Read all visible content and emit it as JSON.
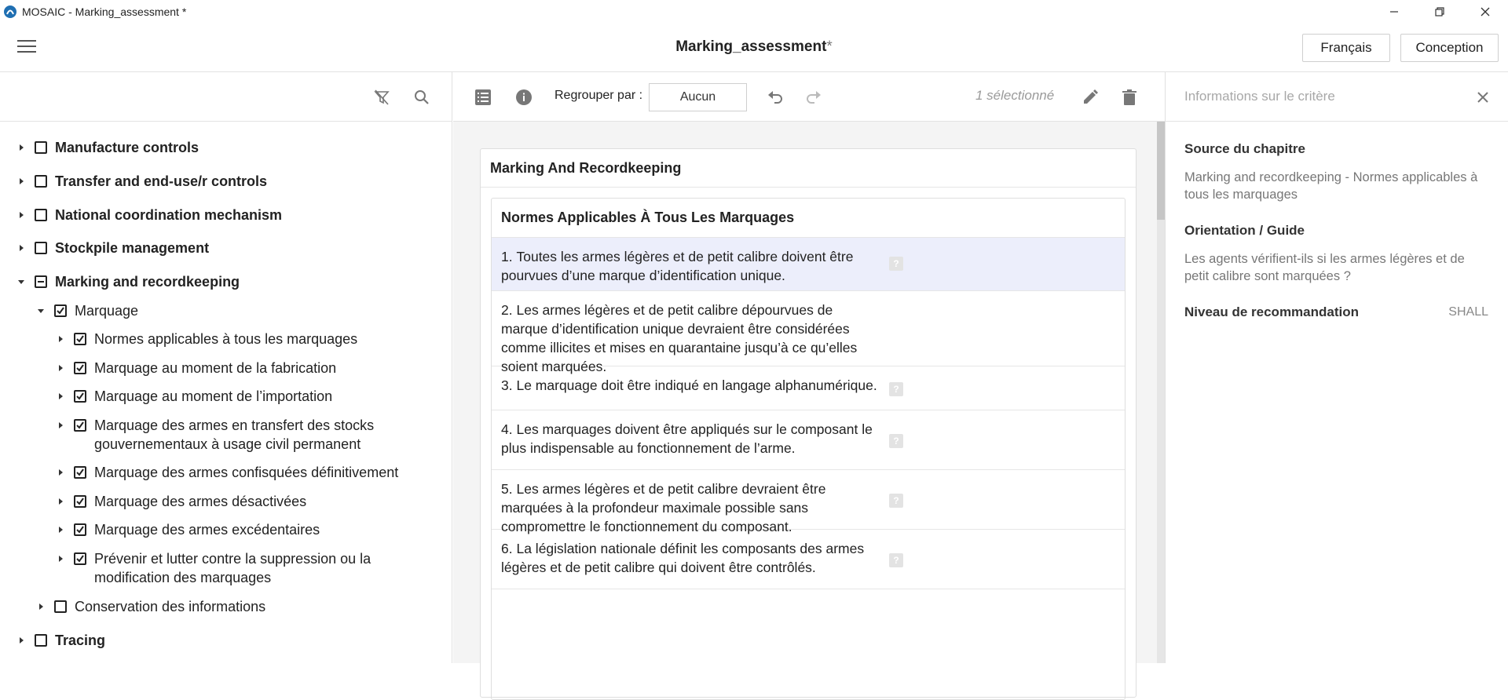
{
  "window": {
    "title": "MOSAIC - Marking_assessment *"
  },
  "header": {
    "doc_title": "Marking_assessment",
    "modified_mark": "*",
    "language_button": "Français",
    "mode_button": "Conception"
  },
  "tree": {
    "items": [
      {
        "label": "Manufacture controls",
        "level": 0,
        "expanded": false,
        "checked": "none",
        "bold": true
      },
      {
        "label": "Transfer and end-use/r controls",
        "level": 0,
        "expanded": false,
        "checked": "none",
        "bold": true
      },
      {
        "label": "National coordination mechanism",
        "level": 0,
        "expanded": false,
        "checked": "none",
        "bold": true
      },
      {
        "label": "Stockpile management",
        "level": 0,
        "expanded": false,
        "checked": "none",
        "bold": true
      },
      {
        "label": "Marking and recordkeeping",
        "level": 0,
        "expanded": true,
        "checked": "partial",
        "bold": true
      },
      {
        "label": "Marquage",
        "level": 1,
        "expanded": true,
        "checked": "checked",
        "bold": false
      },
      {
        "label": "Normes applicables à tous les marquages",
        "level": 2,
        "expanded": false,
        "checked": "checked",
        "bold": false
      },
      {
        "label": "Marquage au moment de la fabrication",
        "level": 2,
        "expanded": false,
        "checked": "checked",
        "bold": false
      },
      {
        "label": "Marquage au moment de l’importation",
        "level": 2,
        "expanded": false,
        "checked": "checked",
        "bold": false
      },
      {
        "label": "Marquage des armes en transfert des stocks\ngouvernementaux à usage civil permanent",
        "level": 2,
        "expanded": false,
        "checked": "checked",
        "bold": false
      },
      {
        "label": "Marquage des armes confisquées définitivement",
        "level": 2,
        "expanded": false,
        "checked": "checked",
        "bold": false
      },
      {
        "label": "Marquage des armes désactivées",
        "level": 2,
        "expanded": false,
        "checked": "checked",
        "bold": false
      },
      {
        "label": "Marquage des armes excédentaires",
        "level": 2,
        "expanded": false,
        "checked": "checked",
        "bold": false
      },
      {
        "label": "Prévenir et lutter contre la suppression ou la\nmodification des marquages",
        "level": 2,
        "expanded": false,
        "checked": "checked",
        "bold": false
      },
      {
        "label": "Conservation des informations",
        "level": 1,
        "expanded": false,
        "checked": "none",
        "bold": false
      },
      {
        "label": "Tracing",
        "level": 0,
        "expanded": false,
        "checked": "none",
        "bold": true
      }
    ]
  },
  "toolbar": {
    "group_by_label": "Regrouper par :",
    "group_by_value": "Aucun",
    "selected_count": "1 sélectionné"
  },
  "card": {
    "title": "Marking And Recordkeeping",
    "section_title": "Normes Applicables À Tous Les Marquages",
    "criteria": [
      {
        "num": "1.",
        "text": "Toutes les armes légères et de petit calibre doivent être pourvues d’une marque d’identification unique.",
        "selected": true,
        "help": "?"
      },
      {
        "num": "2.",
        "text": "Les armes légères et de petit calibre dépourvues de marque d’identification unique devraient être considérées comme illicites et mises en quarantaine jusqu’à ce qu’elles soient marquées.",
        "selected": false,
        "help": ""
      },
      {
        "num": "3.",
        "text": "Le marquage doit être indiqué en langage alphanumérique.",
        "selected": false,
        "help": "?"
      },
      {
        "num": "4.",
        "text": "Les marquages doivent être appliqués sur le composant le plus indispensable au fonctionnement de l’arme.",
        "selected": false,
        "help": "?"
      },
      {
        "num": "5.",
        "text": "Les armes légères et de petit calibre devraient être marquées à la profondeur maximale possible sans compromettre le fonctionnement du composant.",
        "selected": false,
        "help": "?"
      },
      {
        "num": "6.",
        "text": "La législation nationale définit les composants des armes légères et de petit calibre qui doivent être contrôlés.",
        "selected": false,
        "help": "?"
      }
    ]
  },
  "right_panel": {
    "title": "Informations sur le critère",
    "source_label": "Source du chapitre",
    "source_text": "Marking and recordkeeping - Normes applicables à tous les marquages",
    "guide_label": "Orientation / Guide",
    "guide_text": "Les agents vérifient-ils si les armes légères et de petit calibre sont marquées ?",
    "level_label": "Niveau de recommandation",
    "level_value": "SHALL"
  },
  "colors": {
    "selected_row": "#eceefb",
    "panel_bg": "#f4f4f4",
    "muted_text": "#777777"
  }
}
